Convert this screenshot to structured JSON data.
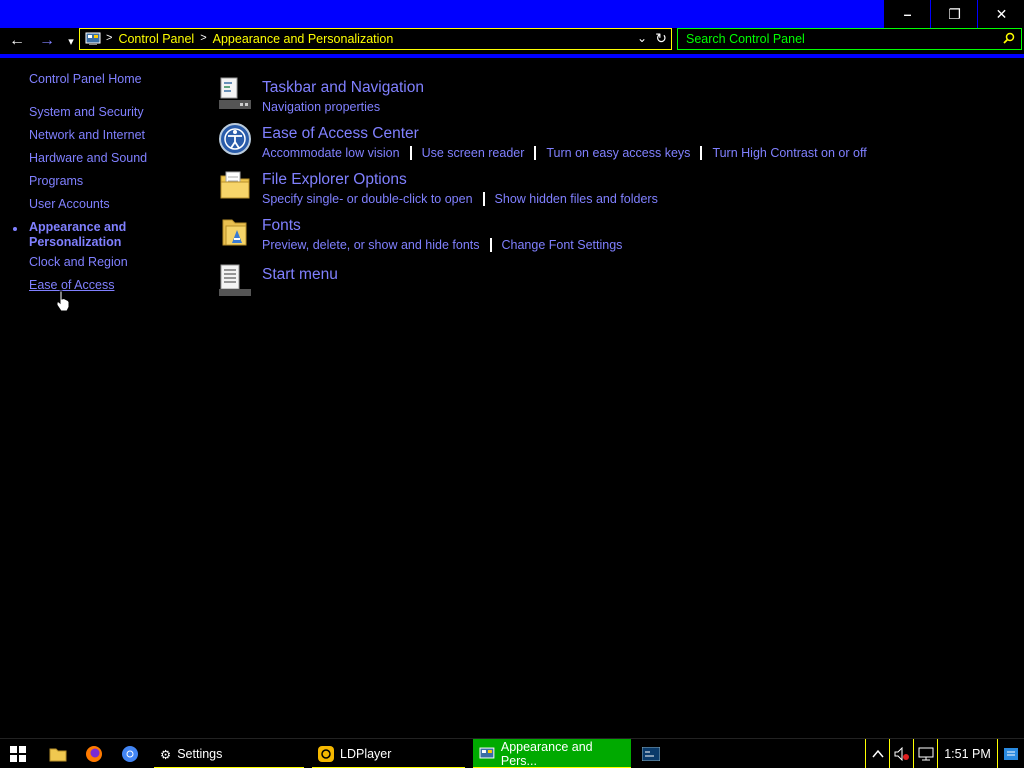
{
  "window": {
    "controls": {
      "minimize": "–",
      "restore": "❐",
      "close": "✕"
    }
  },
  "address": {
    "crumbs": [
      "Control Panel",
      "Appearance and Personalization"
    ],
    "separator": ">",
    "back": "←",
    "forward": "→",
    "recent": "▾",
    "dropdown": "⌄",
    "refresh": "↻"
  },
  "search": {
    "placeholder": "Search Control Panel",
    "icon": "search-icon"
  },
  "leftnav": {
    "home": "Control Panel Home",
    "items": [
      "System and Security",
      "Network and Internet",
      "Hardware and Sound",
      "Programs",
      "User Accounts",
      "Appearance and Personalization",
      "Clock and Region",
      "Ease of Access"
    ]
  },
  "items": [
    {
      "title": "Taskbar and Navigation",
      "links": [
        "Navigation properties"
      ]
    },
    {
      "title": "Ease of Access Center",
      "links": [
        "Accommodate low vision",
        "Use screen reader",
        "Turn on easy access keys",
        "Turn High Contrast on or off"
      ]
    },
    {
      "title": "File Explorer Options",
      "links": [
        "Specify single- or double-click to open",
        "Show hidden files and folders"
      ]
    },
    {
      "title": "Fonts",
      "links": [
        "Preview, delete, or show and hide fonts",
        "Change Font Settings"
      ]
    },
    {
      "title": "Start menu",
      "links": []
    }
  ],
  "taskbar": {
    "apps": [
      "Settings",
      "LDPlayer",
      "Appearance and Pers..."
    ],
    "time": "1:51 PM"
  },
  "colors": {
    "titlebar": "#0000ff",
    "link": "#8080ff",
    "crumb": "#ffff00",
    "search": "#00ff00",
    "active_task": "#00aa00"
  }
}
